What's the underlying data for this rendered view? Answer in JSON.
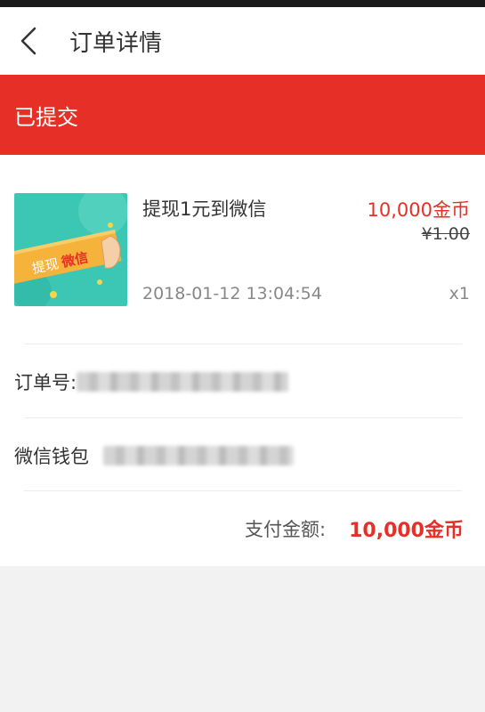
{
  "header": {
    "title": "订单详情"
  },
  "status": {
    "text": "已提交"
  },
  "product": {
    "thumb_text_a": "提现",
    "thumb_text_b": "微信",
    "name": "提现1元到微信",
    "price": "10,000金币",
    "original_price": "¥1.00",
    "time": "2018-01-12 13:04:54",
    "quantity": "x1"
  },
  "order": {
    "number_label": "订单号:",
    "wallet_label": "微信钱包"
  },
  "payment": {
    "label": "支付金额:",
    "value": "10,000金币"
  },
  "colors": {
    "accent": "#e63027",
    "thumb_bg": "#3cc7b4",
    "thumb_ribbon": "#f6b33c"
  }
}
